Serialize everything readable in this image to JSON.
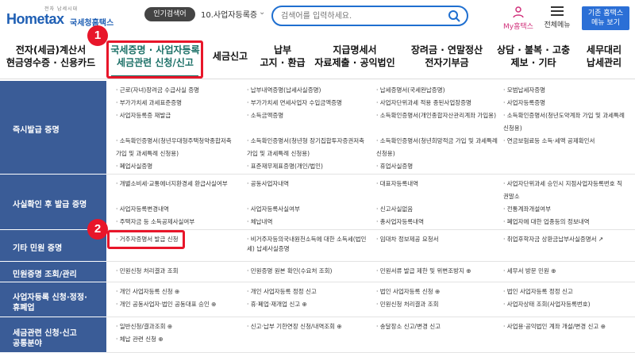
{
  "header": {
    "logo_small": "전자 납세시대",
    "logo_text": "Hometax",
    "logo_kr": "국세청홈택스",
    "popular_label": "인기검색어",
    "popular_value": "10.사업자등록증",
    "search_placeholder": "검색어를 입력하세요.",
    "my_label": "My홈택스",
    "all_menu_label": "전체메뉴",
    "old_home_line1": "기존 홈택스",
    "old_home_line2": "메뉴 보기"
  },
  "gnb": [
    {
      "l1": "전자(세금)계산서",
      "l2": "현금영수증 · 신용카드"
    },
    {
      "l1": "국세증명 · 사업자등록",
      "l2": "세금관련 신청/신고",
      "active": true
    },
    {
      "l1": "세금신고",
      "l2": ""
    },
    {
      "l1": "납부",
      "l2": "고지 · 환급"
    },
    {
      "l1": "지급명세서",
      "l2": "자료제출 · 공익법인"
    },
    {
      "l1": "장려금 · 연말정산",
      "l2": "전자기부금"
    },
    {
      "l1": "상담 · 불복 · 고충",
      "l2": "제보 · 기타"
    },
    {
      "l1": "세무대리",
      "l2": "납세관리"
    }
  ],
  "badges": [
    "1",
    "2"
  ],
  "sections": [
    {
      "title": "즉시발급 증명",
      "cells": [
        "· 근로(자녀)장려금 수급사실 증명",
        "· 납부내역증명(납세사실증명)",
        "· 납세증명서(국세완납증명)",
        "· 모범납세자증명",
        "· 부가가치세 과세표준증명",
        "· 부가가치세 면세사업자 수입금액증명",
        "· 사업자단위과세 적용 종된사업장증명",
        "· 사업자등록증명",
        "· 사업자등록증 재발급",
        "· 소득금액증명",
        "· 소득확인증명서(개인종합자산관리계좌 가입용)",
        "· 소득확인증명서(청년도약계좌 가입 및 과세특례",
        "",
        "",
        "",
        "  신청용)",
        "· 소득확인증명서(청년우대형주택청약종합저축",
        "· 소득확인증명서(청년형 장기집합투자증권저축",
        "· 소득확인증명서(청년희망적금 가입 및 과세특례",
        "· 연금보험료등 소득·세액 공제확인서",
        "  가입 및 과세특례 신청용)",
        "  가입 및 과세특례 신청용)",
        "  신청용)",
        "",
        "· 폐업사실증명",
        "· 표준재무제표증명(개인/법인)",
        "· 휴업사실증명",
        ""
      ]
    },
    {
      "title": "사실확인 후 발급 증명",
      "cells": [
        "· 개별소비세·교통에너지환경세 환급사실여부",
        "· 공동사업자내역",
        "· 대표자등록내역",
        "· 사업자단위과세 승인시 지점사업자등록번호 직",
        "",
        "",
        "",
        "  권말소",
        "· 사업자등록변경내역",
        "· 사업자등록사실여부",
        "· 신고사실없음",
        "· 전통계좌개설여부",
        "· 주택자금 등 소득공제사실여부",
        "· 체납내역",
        "· 총사업자등록내역",
        "· 폐업자에 대한 업종등의 정보내역"
      ]
    },
    {
      "title": "기타 민원 증명",
      "cells": [
        "· 거주자증명서 발급 신청",
        "· 비거주자등의국내원천소득에 대한 소득세(법인",
        "· 임대차 정보제공 요청서",
        "· 취업후학자금 상환금납부사실증명서 ↗",
        "",
        "  세) 납세사실증명",
        "",
        ""
      ]
    },
    {
      "title": "민원증명 조회/관리",
      "cells": [
        "· 민원신청 처리결과 조회",
        "· 민원증명 원본 확인(수요처 조회)",
        "· 민원서류 발급 제한 및 위변조방지 ⊕",
        "· 세무서 방문 민원 ⊕"
      ]
    },
    {
      "title": "사업자등록 신청·정정·휴폐업",
      "title_l1": "사업자등록 신청·정정·",
      "title_l2": "휴폐업",
      "cells": [
        "· 개인 사업자등록 신청 ⊕",
        "· 개인 사업자등록 정정 신고",
        "· 법인 사업자등록 신청 ⊕",
        "· 법인 사업자등록 정정 신고",
        "· 개인 공동사업자·법인 공동대표 승인 ⊕",
        "· 휴·폐업·재개업 신고 ⊕",
        "· 민원신청 처리결과 조회",
        "· 사업자상태 조회(사업자등록번호)"
      ]
    },
    {
      "title": "세금관련 신청·신고 공통분야",
      "title_l1": "세금관련 신청·신고",
      "title_l2": "공통분야",
      "cells": [
        "· 일반신청/결과조회 ⊕",
        "· 신고·납부 기한연장 신청/내역조회 ⊕",
        "· 송달장소 신고/변경 신고",
        "· 사업용·공익법인 계좌 개설/변경 신고 ⊕",
        "· 체납 관련 신청 ⊕",
        "",
        "",
        ""
      ]
    }
  ]
}
